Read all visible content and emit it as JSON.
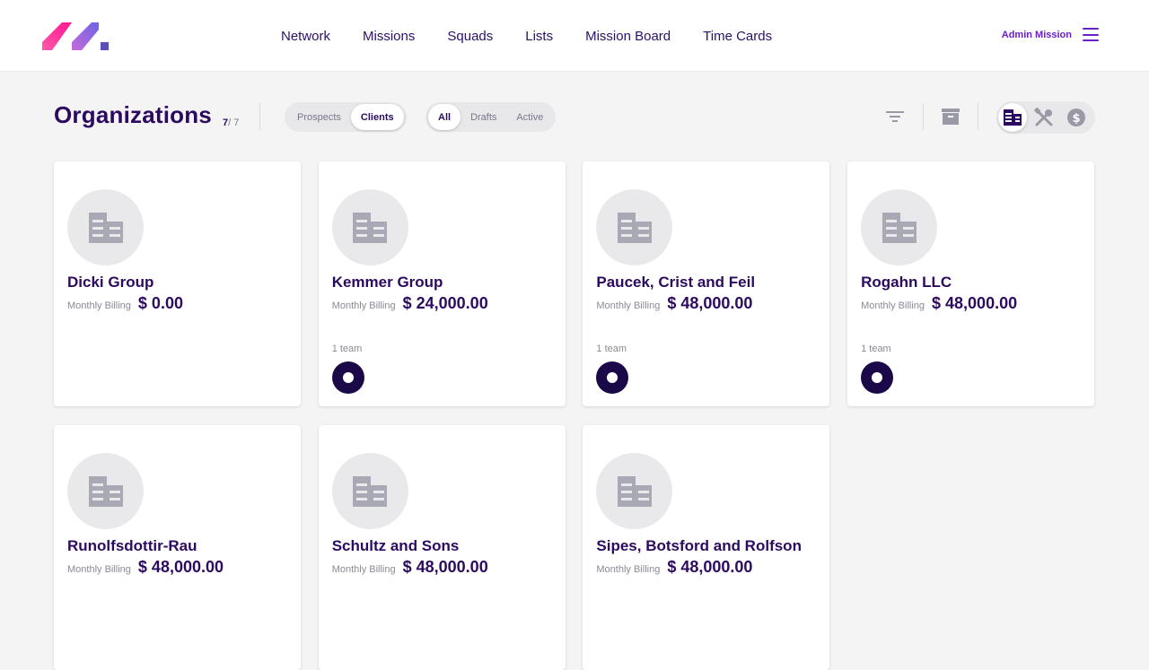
{
  "nav": [
    "Network",
    "Missions",
    "Squads",
    "Lists",
    "Mission Board",
    "Time Cards"
  ],
  "admin": {
    "label": "Admin Mission"
  },
  "page": {
    "title": "Organizations",
    "count_shown": "7",
    "count_total": "/ 7"
  },
  "type_filter": {
    "options": [
      "Prospects",
      "Clients"
    ],
    "selected": "Clients"
  },
  "status_filter": {
    "options": [
      "All",
      "Drafts",
      "Active"
    ],
    "selected": "All"
  },
  "tools": {
    "filter_icon": "filter-icon",
    "archive_icon": "archive-icon",
    "views": [
      "organization-view-icon",
      "skills-view-icon",
      "billing-view-icon"
    ],
    "selected_view": "organization-view-icon"
  },
  "colors": {
    "brand_purple": "#2b0a60",
    "accent": "#6a1fc7",
    "team_dot": "#1a0848",
    "logo_pink": "#ff2d95",
    "logo_violet": "#8b5cf6"
  },
  "organizations": [
    {
      "name": "Dicki Group",
      "billing_label": "Monthly Billing",
      "billing": "$ 0.00",
      "teams": ""
    },
    {
      "name": "Kemmer Group",
      "billing_label": "Monthly Billing",
      "billing": "$ 24,000.00",
      "teams": "1 team"
    },
    {
      "name": "Paucek, Crist and Feil",
      "billing_label": "Monthly Billing",
      "billing": "$ 48,000.00",
      "teams": "1 team"
    },
    {
      "name": "Rogahn LLC",
      "billing_label": "Monthly Billing",
      "billing": "$ 48,000.00",
      "teams": "1 team"
    },
    {
      "name": "Runolfsdottir-Rau",
      "billing_label": "Monthly Billing",
      "billing": "$ 48,000.00",
      "teams": ""
    },
    {
      "name": "Schultz and Sons",
      "billing_label": "Monthly Billing",
      "billing": "$ 48,000.00",
      "teams": ""
    },
    {
      "name": "Sipes, Botsford and Rolfson",
      "billing_label": "Monthly Billing",
      "billing": "$ 48,000.00",
      "teams": ""
    }
  ]
}
